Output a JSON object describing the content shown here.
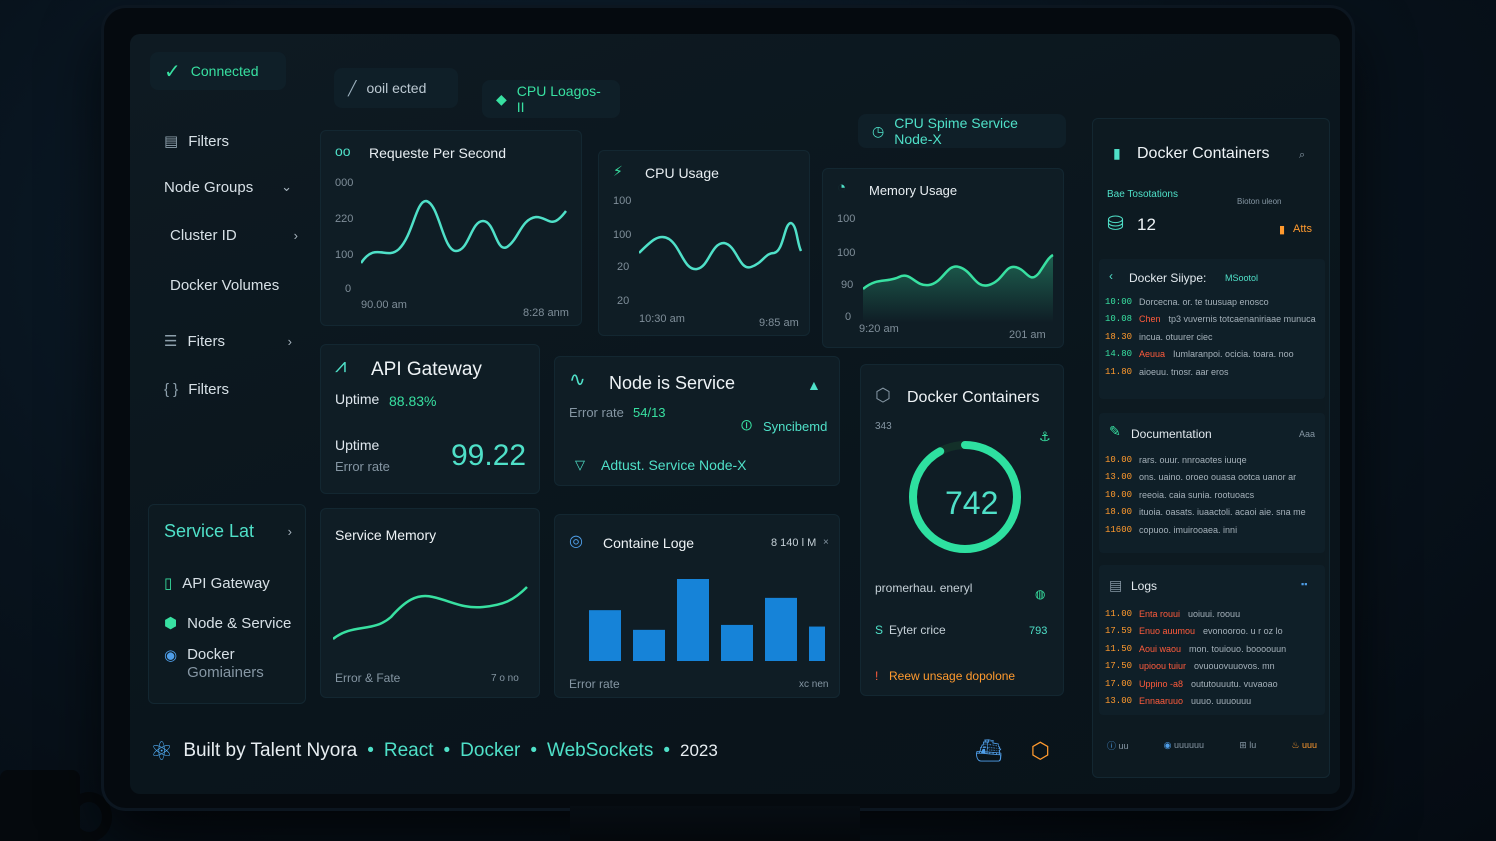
{
  "status": {
    "label": "Connected"
  },
  "top_pills": {
    "conn": "ooil ected",
    "cpu": "CPU Loagos-II",
    "service": "CPU Spime Service Node-X"
  },
  "sidebar": {
    "items": [
      {
        "label": "Filters",
        "icon": "filter-icon"
      },
      {
        "label": "Node Groups",
        "icon": "chevron-down-icon"
      },
      {
        "label": "Cluster ID",
        "icon": "chevron-right-icon"
      },
      {
        "label": "Docker Volumes",
        "icon": ""
      },
      {
        "label": "Fiters",
        "icon": "list-icon"
      },
      {
        "label": "Filters",
        "icon": "code-icon"
      }
    ],
    "service_list": {
      "title": "Service Lat",
      "items": [
        {
          "label": "API Gateway"
        },
        {
          "label": "Node & Service"
        },
        {
          "label": "Docker",
          "sub": "Gomiainers"
        }
      ]
    }
  },
  "rps_chart": {
    "title": "Requeste Per Second",
    "yticks": [
      "000",
      "220",
      "100",
      "0"
    ],
    "xticks": [
      "90.00 am",
      "8:28 anm"
    ]
  },
  "cpu_chart": {
    "title": "CPU Usage",
    "yticks": [
      "100",
      "100",
      "20",
      "20"
    ],
    "xticks": [
      "10:30 am",
      "9:85 am"
    ]
  },
  "mem_chart": {
    "title": "Memory Usage",
    "yticks": [
      "100",
      "100",
      "90",
      "0"
    ],
    "xticks": [
      "9:20 am",
      "201 am"
    ]
  },
  "api_gateway": {
    "title": "API Gateway",
    "uptime_label": "Uptime",
    "uptime_value": "88.83%",
    "uptime2": "Uptime",
    "error_rate_label": "Error rate",
    "big_value": "99.22"
  },
  "node_service": {
    "title": "Node is Service",
    "error_label": "Error rate",
    "error_value": "54/13",
    "sync_label": "Syncibemd",
    "adjust_label": "Adtust. Service Node-X"
  },
  "service_memory": {
    "title": "Service Memory",
    "footer_left": "Error & Fate",
    "footer_right": "7 o no"
  },
  "container_logs": {
    "title": "Containe Loge",
    "value": "8 140 l M",
    "footer_left": "Error rate",
    "footer_right": "xc nen",
    "bars": [
      0.62,
      0.38,
      1.0,
      0.44,
      0.77,
      0.42
    ]
  },
  "docker_gauge": {
    "title": "Docker Containers",
    "sub": "343",
    "value": "742",
    "fraction": 0.92,
    "label1": "promerhau. eneryl",
    "label2": "Eyter crice",
    "label2_value": "793",
    "label3": "Reew unsage dopolone"
  },
  "right_panel": {
    "title": "Docker Containers",
    "sub_label": "Bae Tosotations",
    "count": "12",
    "alerts": "Atts",
    "right_small": "Bioton uleon",
    "docker_section": {
      "title": "Docker Siiype:",
      "tag": "MSootol",
      "rows": [
        {
          "time": "10:00",
          "tag": "",
          "msg": "Dorcecna. or. te tuusuap enosco",
          "color": "#38e0a1"
        },
        {
          "time": "10.08",
          "tag": "Chen",
          "msg": "tp3 vuvernis totcaenaniriaae munuca",
          "color": "#38e0a1"
        },
        {
          "time": "18.30",
          "tag": "",
          "msg": "incua. otuurer ciec",
          "color": "#ff9a2e"
        },
        {
          "time": "14.80",
          "tag": "Aeuua",
          "msg": "Iumlaranpoi. ocicia. toara. noo",
          "color": "#38e0a1"
        },
        {
          "time": "11.80",
          "tag": "",
          "msg": "aioeuu. tnosr. aar eros",
          "color": "#ff9a2e"
        }
      ]
    },
    "documentation": {
      "title": "Documentation",
      "badge": "Aaa",
      "rows": [
        {
          "time": "10.00",
          "tag": "",
          "msg": "rars. ouur. nnroaotes iuuqe",
          "color": "#ff9a2e"
        },
        {
          "time": "13.00",
          "tag": "",
          "msg": "ons. uaino. oroeo ouasa ootca uanor ar",
          "color": "#ff9a2e"
        },
        {
          "time": "10.00",
          "tag": "",
          "msg": "reeoia. caia sunia. rootuoacs",
          "color": "#ff9a2e"
        },
        {
          "time": "18.00",
          "tag": "",
          "msg": "ituoia. oasats. iuaactoli. acaoi aie. sna me",
          "color": "#ff9a2e"
        },
        {
          "time": "11600",
          "tag": "",
          "msg": "copuoo. imuirooaea. inni",
          "color": "#ff9a2e"
        }
      ]
    },
    "logs": {
      "title": "Logs",
      "rows": [
        {
          "time": "11.00",
          "tag": "Enta rouui",
          "msg": "uoiuui. roouu",
          "color": "#ff9a2e"
        },
        {
          "time": "17.59",
          "tag": "Enuo auumou",
          "msg": "evonooroo. u r oz lo",
          "color": "#ff9a2e"
        },
        {
          "time": "11.50",
          "tag": "Aoui waou",
          "msg": "mon. touiouo. boooouun",
          "color": "#ff9a2e"
        },
        {
          "time": "17.50",
          "tag": "upioou tuiur",
          "msg": "ovuouovuuovos. mn",
          "color": "#ff9a2e"
        },
        {
          "time": "17.00",
          "tag": "Uppino -a8",
          "msg": "oututouuutu. vuvaoao",
          "color": "#ff9a2e"
        },
        {
          "time": "13.00",
          "tag": "Ennaaruuo",
          "msg": "uuuo. uuuouuu",
          "color": "#ff9a2e"
        }
      ]
    },
    "bottom": [
      "uu",
      "uuuuuu",
      "lu",
      "uuu"
    ]
  },
  "footer": {
    "built_by": "Built by Talent Nyora",
    "tech": [
      "React",
      "Docker",
      "WebSockets"
    ],
    "year": "2023"
  },
  "colors": {
    "accent": "#38e0a1",
    "teal": "#4fe0c8",
    "bar": "#1683d8",
    "warn": "#ff9a2e",
    "error": "#ff5b3c"
  }
}
